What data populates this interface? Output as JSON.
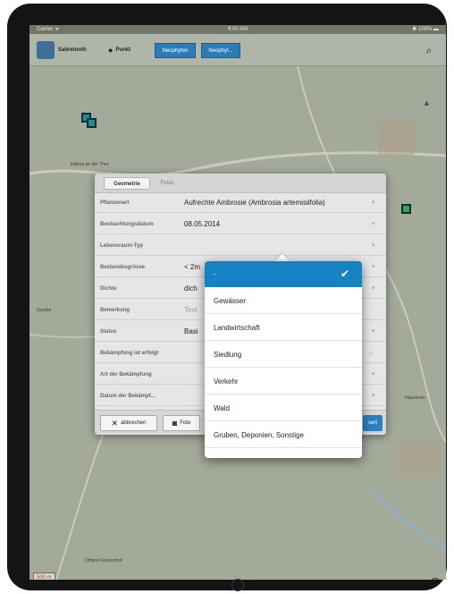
{
  "statusbar": {
    "carrier": "Carrier ᯤ",
    "time": "9:00 AM",
    "battery": "✱ 100% ▬"
  },
  "toolbar": {
    "sabretooth_label": "Sabretooth",
    "punkt_label": "Punkt",
    "btn1_label": "Neophyten",
    "btn2_label": "Neophyt..."
  },
  "map": {
    "label_ettikon": "Ettikon\nan der Thur",
    "label_hausleu": "Häusleren",
    "label_gundet": "Gundet",
    "label_ottikon": "Ottikon\nFürstenhof",
    "label_scale": "500 m",
    "label_marker_a": "A",
    "colors": {
      "map_bg": "#a3aa99",
      "road": "#c9cbbf",
      "marker_teal": "#1c8f8f",
      "marker_green": "#3aa44a"
    }
  },
  "sheet": {
    "tab_geometry": "Geometrie",
    "tab_photos": "Fotos",
    "rows": [
      {
        "label": "Pflanzenart",
        "value": "Aufrechte Ambrosie (Ambrosia artemisiifolia)"
      },
      {
        "label": "Beobachtungsdatum",
        "value": "08.05.2014"
      },
      {
        "label": "Lebensraum-Typ",
        "value": ""
      },
      {
        "label": "Bestandesgrösse",
        "value": "< 2m"
      },
      {
        "label": "Dichte",
        "value": "dich"
      },
      {
        "label": "Bemerkung",
        "value": "Text"
      },
      {
        "label": "Status",
        "value": "Basi"
      },
      {
        "label": "Bekämpfung ist erfolgt",
        "value": ""
      },
      {
        "label": "Art der Bekämpfung",
        "value": ""
      },
      {
        "label": "Datum der Bekämpf...",
        "value": ""
      }
    ],
    "cancel_label": "abbrechen",
    "photo_label": "Foto",
    "save_label": "sert"
  },
  "popover": {
    "options": [
      "-",
      "Gewässer",
      "Landwirtschaft",
      "Siedlung",
      "Verkehr",
      "Wald",
      "Gruben, Deponien, Sonstige"
    ],
    "selected_index": 0,
    "accent": "#1682c4"
  }
}
